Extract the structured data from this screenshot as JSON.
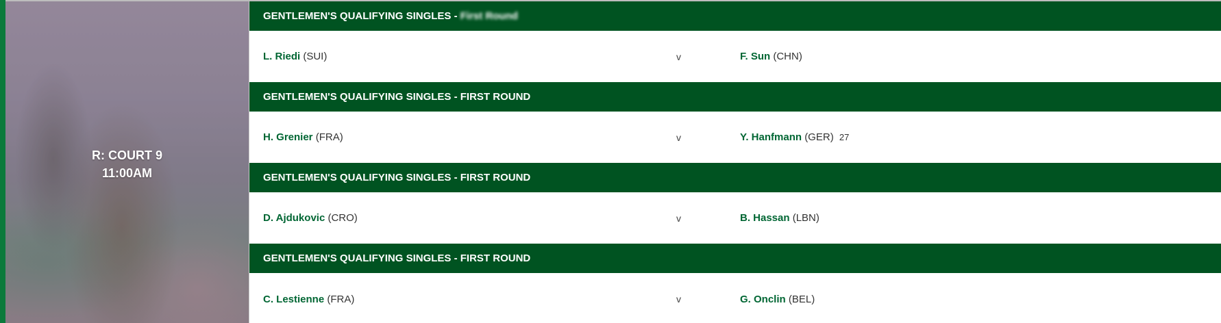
{
  "court": {
    "name": "R: COURT 9",
    "time": "11:00AM"
  },
  "matches": [
    {
      "round_prefix": "GENTLEMEN'S QUALIFYING SINGLES -",
      "round_suffix": "First Round",
      "round_suffix_obscured": true,
      "left": {
        "name": "L. Riedi",
        "country": "(SUI)",
        "seed": ""
      },
      "versus": "v",
      "right": {
        "name": "F. Sun",
        "country": "(CHN)",
        "seed": ""
      }
    },
    {
      "round_prefix": "GENTLEMEN'S QUALIFYING SINGLES - FIRST ROUND",
      "round_suffix": "",
      "round_suffix_obscured": false,
      "left": {
        "name": "H. Grenier",
        "country": "(FRA)",
        "seed": ""
      },
      "versus": "v",
      "right": {
        "name": "Y. Hanfmann",
        "country": "(GER)",
        "seed": "27"
      }
    },
    {
      "round_prefix": "GENTLEMEN'S QUALIFYING SINGLES - FIRST ROUND",
      "round_suffix": "",
      "round_suffix_obscured": false,
      "left": {
        "name": "D. Ajdukovic",
        "country": "(CRO)",
        "seed": ""
      },
      "versus": "v",
      "right": {
        "name": "B. Hassan",
        "country": "(LBN)",
        "seed": ""
      }
    },
    {
      "round_prefix": "GENTLEMEN'S QUALIFYING SINGLES - FIRST ROUND",
      "round_suffix": "",
      "round_suffix_obscured": false,
      "left": {
        "name": "C. Lestienne",
        "country": "(FRA)",
        "seed": ""
      },
      "versus": "v",
      "right": {
        "name": "G. Onclin",
        "country": "(BEL)",
        "seed": ""
      }
    }
  ],
  "colors": {
    "round_bar": "#005321",
    "player_name": "#006633",
    "left_stripe": "#0b7a3b"
  }
}
